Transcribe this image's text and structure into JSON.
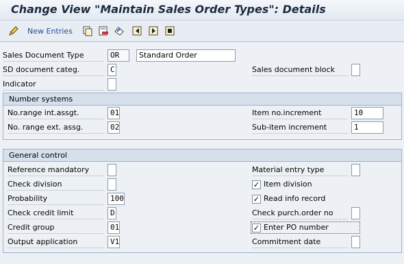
{
  "title": "Change View \"Maintain Sales Order Types\": Details",
  "toolbar": {
    "new_entries": "New Entries",
    "icons": [
      "pen-icon",
      "copy-icon",
      "delete-icon",
      "undo-icon",
      "first-icon",
      "previous-icon",
      "next-icon"
    ]
  },
  "header": {
    "sales_doc_type_label": "Sales Document Type",
    "sales_doc_type_value": "OR",
    "sales_doc_type_desc": "Standard Order",
    "sd_categ_label": "SD document categ.",
    "sd_categ_value": "C",
    "sales_doc_block_label": "Sales document block",
    "sales_doc_block_value": "",
    "indicator_label": "Indicator",
    "indicator_value": ""
  },
  "number_systems": {
    "title": "Number systems",
    "int_range_label": "No.range int.assgt.",
    "int_range_value": "01",
    "ext_range_label": "No. range ext. assg.",
    "ext_range_value": "02",
    "item_incr_label": "Item no.increment",
    "item_incr_value": "10",
    "subitem_incr_label": "Sub-item increment",
    "subitem_incr_value": "1"
  },
  "general_control": {
    "title": "General control",
    "reference_mandatory_label": "Reference mandatory",
    "reference_mandatory_value": "",
    "check_division_label": "Check division",
    "check_division_value": "",
    "probability_label": "Probability",
    "probability_value": "100",
    "check_credit_limit_label": "Check credit limit",
    "check_credit_limit_value": "D",
    "credit_group_label": "Credit group",
    "credit_group_value": "01",
    "output_application_label": "Output application",
    "output_application_value": "V1",
    "material_entry_type_label": "Material entry type",
    "material_entry_type_value": "",
    "item_division_label": "Item division",
    "item_division_checked": true,
    "read_info_record_label": "Read info record",
    "read_info_record_checked": true,
    "check_purch_order_label": "Check purch.order no",
    "check_purch_order_value": "",
    "enter_po_label": "Enter PO number",
    "enter_po_checked": true,
    "commitment_date_label": "Commitment  date",
    "commitment_date_value": ""
  },
  "colors": {
    "title_text": "#1c2a40",
    "link": "#1f4f9a",
    "group_header": "#d6e0ec",
    "background": "#edf1f6"
  }
}
